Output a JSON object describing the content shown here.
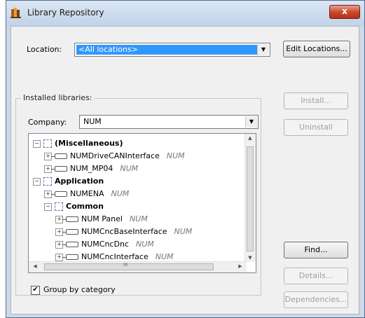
{
  "window": {
    "title": "Library Repository",
    "close_glyph": "x"
  },
  "location": {
    "label": "Location:",
    "value": "<All locations>",
    "edit_button": "Edit Locations..."
  },
  "installed": {
    "group_label": "Installed libraries:",
    "company_label": "Company:",
    "company_value": "NUM",
    "group_by_category_label": "Group by category",
    "group_by_category_checked": true
  },
  "tree": {
    "items": [
      {
        "label": "(Miscellaneous)",
        "company": "",
        "type": "category",
        "expander": "−"
      },
      {
        "label": "NUMDriveCANInterface",
        "company": "NUM",
        "type": "library",
        "expander": "+"
      },
      {
        "label": "NUM_MP04",
        "company": "NUM",
        "type": "library",
        "expander": "+"
      },
      {
        "label": "Application",
        "company": "",
        "type": "category",
        "expander": "−"
      },
      {
        "label": "NUMENA",
        "company": "NUM",
        "type": "library",
        "expander": "+"
      },
      {
        "label": "Common",
        "company": "",
        "type": "category",
        "expander": "−"
      },
      {
        "label": "NUM Panel",
        "company": "NUM",
        "type": "library",
        "expander": "+"
      },
      {
        "label": "NUMCncBaseInterface",
        "company": "NUM",
        "type": "library",
        "expander": "+"
      },
      {
        "label": "NUMCncDnc",
        "company": "NUM",
        "type": "library",
        "expander": "+"
      },
      {
        "label": "NUMCncInterface",
        "company": "NUM",
        "type": "library",
        "expander": "+"
      }
    ],
    "hscroll_thumb_glyph": "III"
  },
  "buttons": {
    "install": "Install...",
    "uninstall": "Uninstall",
    "find": "Find...",
    "details": "Details...",
    "dependencies": "Dependencies..."
  },
  "colors": {
    "selection": "#3297fd",
    "titlebar": "#c2d3e8",
    "close": "#c9442a",
    "dialog_bg": "#f0f0f0"
  }
}
